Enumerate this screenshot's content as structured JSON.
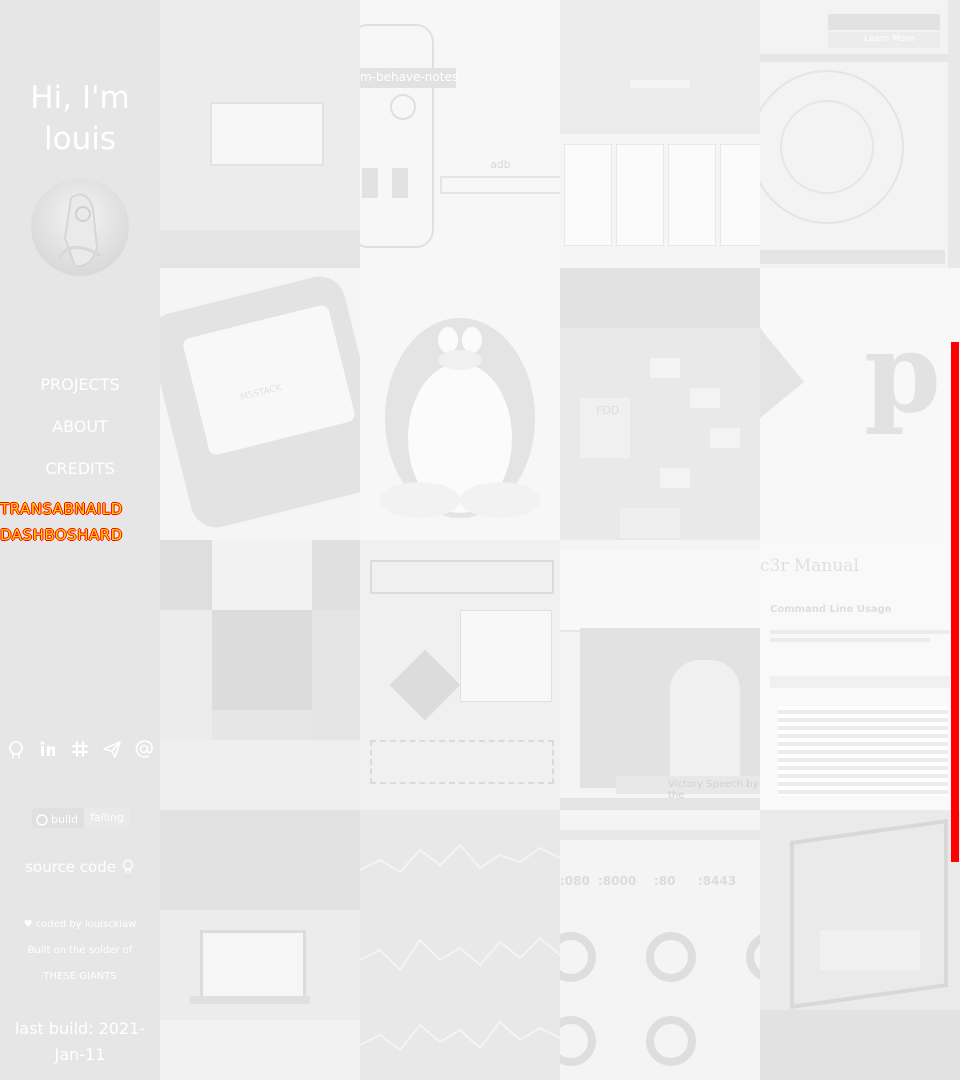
{
  "sidebar": {
    "greeting": "Hi, I'm louis",
    "nav": {
      "projects": "PROJECTS",
      "about": "ABOUT",
      "credits": "CREDITS",
      "glitch_line_1": "TRANSABNAILD",
      "glitch_line_2": "DASHBOSHARD"
    },
    "social_icons": [
      "github-icon",
      "linkedin-icon",
      "slack-icon",
      "telegram-icon",
      "email-icon"
    ],
    "build_badge": {
      "left": "build",
      "right": "failing"
    },
    "source_code": "source code",
    "coded_by": "coded by louisckiaw",
    "built_on": "Built on the solder of",
    "giants": "THESE GIANTS",
    "last_build": "last build: 2021-Jan-11"
  },
  "tiles": {
    "behave_notes_label": "m-behave-notes",
    "adb_label": "adb",
    "manual_title": "c3r Manual",
    "manual_heading": "Command Line Usage",
    "learn_more": "Learn More",
    "ports": [
      ":080",
      ":8000",
      ":80",
      ":8443"
    ],
    "p_letter": "p",
    "m5stack_label": "M5STACK",
    "video_caption": "Victory Speech by the",
    "fdd_label": "FDD"
  },
  "colors": {
    "sidebar_bg": "#e6e6e6",
    "page_bg": "#f2f2f2",
    "glitch_text": "#ffd700",
    "glitch_outline": "#ff0000",
    "accent_red": "#ff0000"
  }
}
